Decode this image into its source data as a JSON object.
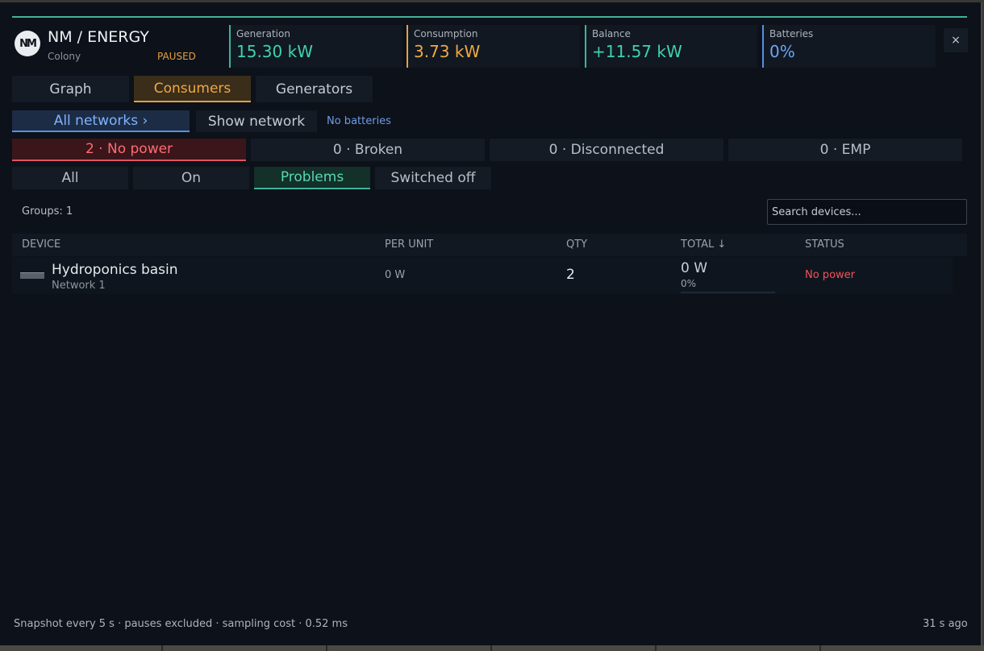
{
  "header": {
    "logo_text": "NM",
    "title": "NM / ENERGY",
    "subtitle": "Colony",
    "state": "PAUSED",
    "close_label": "×"
  },
  "stats": [
    {
      "label": "Generation",
      "value": "15.30 kW",
      "color": "#3fd2ad",
      "accent": "#3fb39a"
    },
    {
      "label": "Consumption",
      "value": "3.73 kW",
      "color": "#f0a942",
      "accent": "#e6a040"
    },
    {
      "label": "Balance",
      "value": "+11.57 kW",
      "color": "#3fd2ad",
      "accent": "#3fb39a"
    },
    {
      "label": "Batteries",
      "value": "0%",
      "color": "#6ea6f5",
      "accent": "#5a8fe0"
    }
  ],
  "tabs": [
    {
      "label": "Graph",
      "active": false
    },
    {
      "label": "Consumers",
      "active": true
    },
    {
      "label": "Generators",
      "active": false
    }
  ],
  "network": {
    "all_label": "All networks  ›",
    "show_label": "Show network",
    "no_batteries": "No batteries"
  },
  "problem_chips": [
    {
      "label": "2 · No power",
      "alert": true
    },
    {
      "label": "0 · Broken",
      "alert": false
    },
    {
      "label": "0 · Disconnected",
      "alert": false
    },
    {
      "label": "0 · EMP",
      "alert": false
    }
  ],
  "filters": [
    {
      "label": "All",
      "active": false
    },
    {
      "label": "On",
      "active": false
    },
    {
      "label": "Problems",
      "active": true
    },
    {
      "label": "Switched off",
      "active": false
    }
  ],
  "groups_label": "Groups: 1",
  "search": {
    "placeholder": "Search devices..."
  },
  "table": {
    "columns": {
      "device": "DEVICE",
      "per_unit": "PER UNIT",
      "qty": "QTY",
      "total": "TOTAL ↓",
      "status": "STATUS"
    },
    "rows": [
      {
        "name": "Hydroponics basin",
        "network": "Network 1",
        "per_unit": "0 W",
        "qty": "2",
        "total": "0 W",
        "total_pct": "0%",
        "status": "No power"
      }
    ]
  },
  "footer": {
    "left": "Snapshot every 5 s · pauses excluded · sampling cost  ·  0.52 ms",
    "right": "31 s ago"
  }
}
